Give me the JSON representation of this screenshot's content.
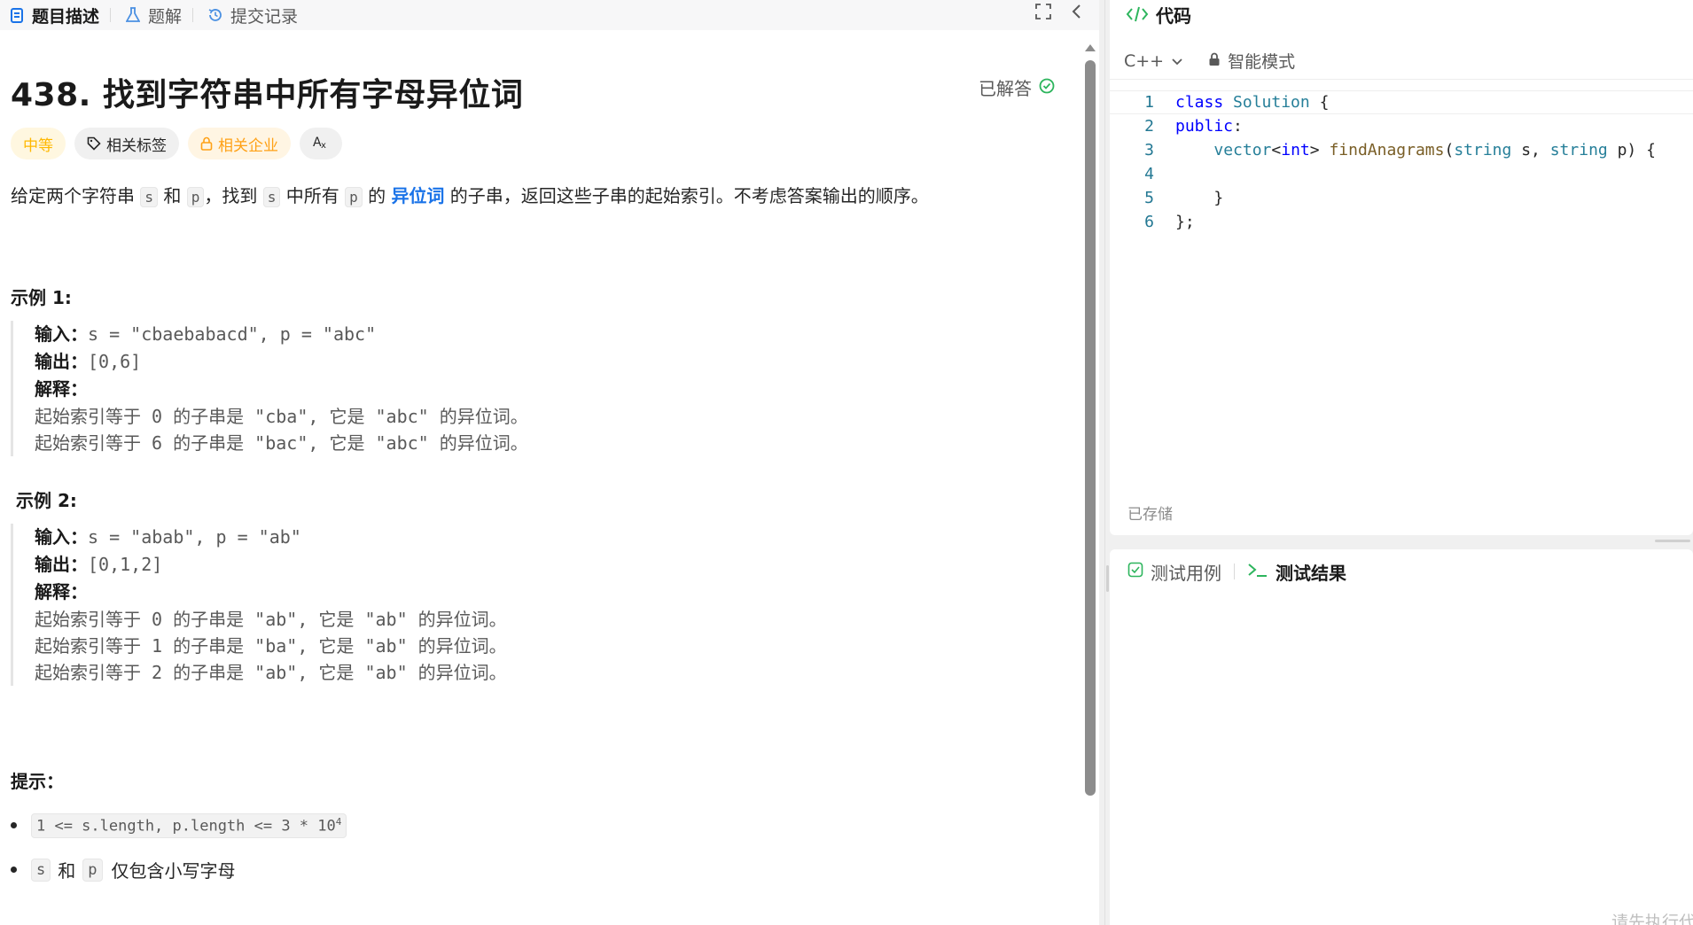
{
  "left_tabs": [
    {
      "label": "题目描述",
      "icon": "document-icon",
      "active": true
    },
    {
      "label": "题解",
      "icon": "flask-icon",
      "active": false
    },
    {
      "label": "提交记录",
      "icon": "history-icon",
      "active": false
    }
  ],
  "problem": {
    "title": "438. 找到字符串中所有字母异位词",
    "status": "已解答",
    "difficulty": "中等",
    "tag_related": "相关标签",
    "tag_company": "相关企业",
    "translate_label": "A文",
    "description": {
      "p1": "给定两个字符串",
      "s": "s",
      "and": "和",
      "p": "p",
      "p2": "，找到",
      "p3": "中所有",
      "p4": "的",
      "link": "异位词",
      "p5": "的子串，返回这些子串的起始索引。不考虑答案输出的顺序。"
    }
  },
  "examples": [
    {
      "title": "示例 1:",
      "input_label": "输入：",
      "input": "s = \"cbaebabacd\", p = \"abc\"",
      "output_label": "输出：",
      "output": "[0,6]",
      "explain_label": "解释：",
      "explain_lines": [
        "起始索引等于 0 的子串是 \"cba\", 它是 \"abc\" 的异位词。",
        "起始索引等于 6 的子串是 \"bac\", 它是 \"abc\" 的异位词。"
      ]
    },
    {
      "title": "示例 2:",
      "input_label": "输入：",
      "input": "s = \"abab\", p = \"ab\"",
      "output_label": "输出：",
      "output": "[0,1,2]",
      "explain_label": "解释：",
      "explain_lines": [
        "起始索引等于 0 的子串是 \"ab\", 它是 \"ab\" 的异位词。",
        "起始索引等于 1 的子串是 \"ba\", 它是 \"ab\" 的异位词。",
        "起始索引等于 2 的子串是 \"ab\", 它是 \"ab\" 的异位词。"
      ]
    }
  ],
  "hints": {
    "title": "提示：",
    "h1_code": "1 <= s.length, p.length <= 3 * 10",
    "h1_sup": "4",
    "h2_s": "s",
    "h2_and": "和",
    "h2_p": "p",
    "h2_text": "仅包含小写字母"
  },
  "code_panel": {
    "title": "代码",
    "language": "C++",
    "mode": "智能模式",
    "lines": [
      {
        "n": "1",
        "text": "class Solution {"
      },
      {
        "n": "2",
        "text": "public:"
      },
      {
        "n": "3",
        "text": "    vector<int> findAnagrams(string s, string p) {"
      },
      {
        "n": "4",
        "text": ""
      },
      {
        "n": "5",
        "text": "    }"
      },
      {
        "n": "6",
        "text": "};"
      }
    ],
    "saved": "已存储"
  },
  "test_panel": {
    "tab_cases": "测试用例",
    "tab_results": "测试结果",
    "hint": "请先执行代"
  },
  "colors": {
    "accent_green": "#2db55d",
    "link_blue": "#1a73e8",
    "difficulty_yellow": "#ffb800"
  }
}
